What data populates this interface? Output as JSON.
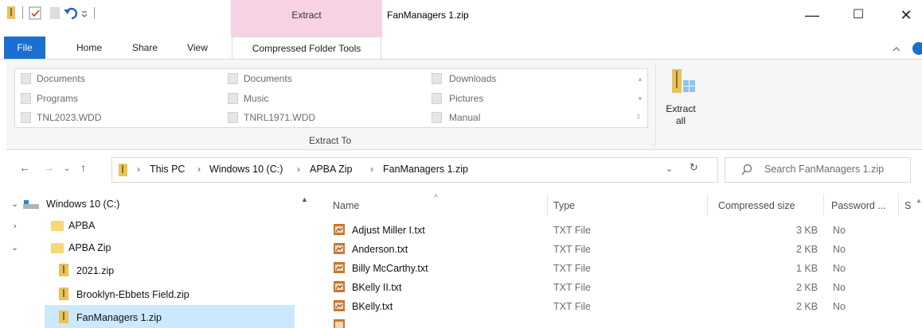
{
  "window": {
    "context_tab": "Extract",
    "title": "FanManagers 1.zip",
    "minimize": "—",
    "maximize": "☐",
    "close": "✕"
  },
  "ribbon": {
    "tabs": [
      "File",
      "Home",
      "Share",
      "View",
      "Compressed Folder Tools"
    ],
    "destinations": [
      [
        "Documents",
        "Documents",
        "Downloads"
      ],
      [
        "Programs",
        "Music",
        "Pictures"
      ],
      [
        "TNL2023.WDD",
        "TNRL1971.WDD",
        "Manual"
      ]
    ],
    "group_label": "Extract To",
    "extract_all_line1": "Extract",
    "extract_all_line2": "all"
  },
  "address": {
    "crumbs": [
      "This PC",
      "Windows 10 (C:)",
      "APBA Zip",
      "FanManagers 1.zip"
    ],
    "search_placeholder": "Search FanManagers 1.zip"
  },
  "nav_pane": {
    "items": [
      {
        "label": "Windows 10 (C:)",
        "expanded": true
      },
      {
        "label": "APBA",
        "expanded": false
      },
      {
        "label": "APBA Zip",
        "expanded": true
      },
      {
        "label": "2021.zip"
      },
      {
        "label": "Brooklyn-Ebbets Field.zip"
      },
      {
        "label": "FanManagers 1.zip",
        "selected": true
      }
    ]
  },
  "file_list": {
    "columns": [
      "Name",
      "Type",
      "Compressed size",
      "Password ...",
      "S"
    ],
    "rows": [
      {
        "name": "Adjust Miller I.txt",
        "type": "TXT File",
        "size": "3 KB",
        "password": "No"
      },
      {
        "name": "Anderson.txt",
        "type": "TXT File",
        "size": "2 KB",
        "password": "No"
      },
      {
        "name": "Billy McCarthy.txt",
        "type": "TXT File",
        "size": "1 KB",
        "password": "No"
      },
      {
        "name": "BKelly II.txt",
        "type": "TXT File",
        "size": "2 KB",
        "password": "No"
      },
      {
        "name": "BKelly.txt",
        "type": "TXT File",
        "size": "2 KB",
        "password": "No"
      }
    ]
  },
  "colors": {
    "file_tab": "#1a6fd0",
    "extract_context": "#f7d2e4",
    "selection": "#cce8ff"
  }
}
